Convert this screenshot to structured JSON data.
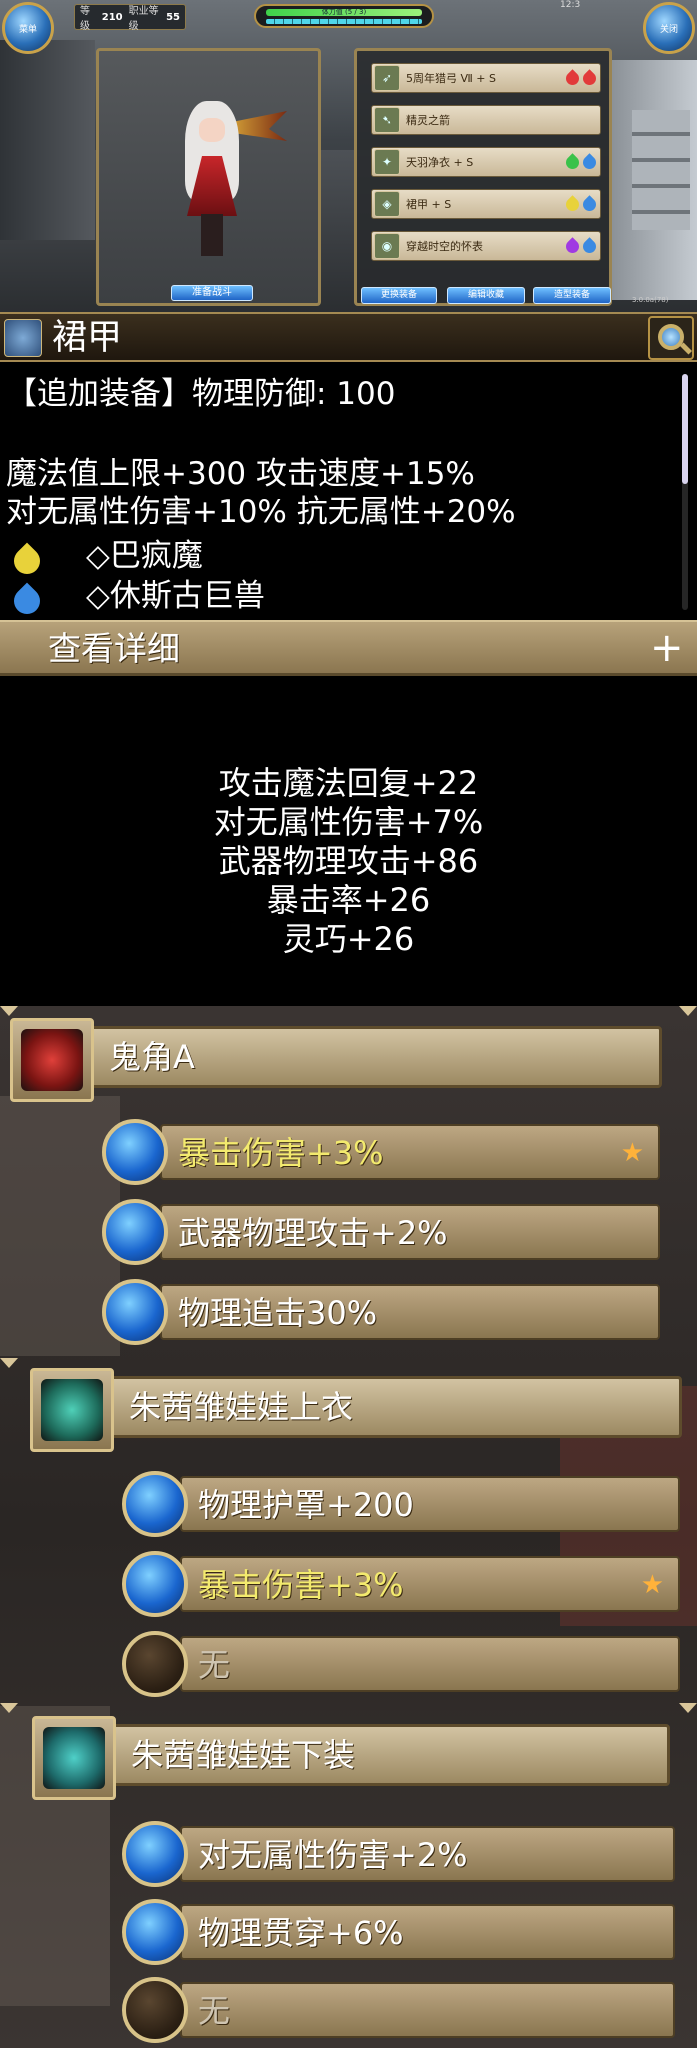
{
  "hud": {
    "left_orb_label": "菜单",
    "right_orb_label": "关闭",
    "level_label": "等级",
    "level_value": "210",
    "job_label": "职业等级",
    "job_value": "55",
    "hp_label": "体力值 (5 / 3)",
    "version": "3.0.0a(78)",
    "clock": "12:3"
  },
  "character": {
    "ready_button": "准备战斗"
  },
  "equipment_panel": {
    "items": [
      {
        "name": "5周年猎弓 Ⅶ + S",
        "icon": "bow-icon",
        "gems": [
          "red",
          "red"
        ]
      },
      {
        "name": "精灵之箭",
        "icon": "arrow-icon",
        "gems": []
      },
      {
        "name": "天羽净衣 + S",
        "icon": "robe-icon",
        "gems": [
          "green",
          "blue"
        ]
      },
      {
        "name": "裙甲 + S",
        "icon": "skirt-icon",
        "gems": [
          "yellow",
          "blue"
        ]
      },
      {
        "name": "穿越时空的怀表",
        "icon": "pocket-watch-icon",
        "gems": [
          "purple",
          "blue"
        ]
      }
    ],
    "buttons": [
      "更换装备",
      "编辑收藏",
      "造型装备"
    ]
  },
  "item": {
    "title": "裙甲",
    "line1": "【追加装备】物理防御: 100",
    "line2": "魔法值上限+300 攻击速度+15%",
    "line3": "对无属性伤害+10% 抗无属性+20%",
    "gem1": "◇巴疯魔",
    "gem2": "◇休斯古巨兽",
    "details_label": "查看详细",
    "details_plus": "+",
    "bonus": [
      "攻击魔法回复+22",
      "对无属性伤害+7%",
      "武器物理攻击+86",
      "暴击率+26",
      "灵巧+26"
    ]
  },
  "sets": [
    {
      "name": "鬼角A",
      "icon": "ribbon-icon",
      "rows": [
        {
          "text": "暴击伤害+3%",
          "style": "hl",
          "star": "★"
        },
        {
          "text": "武器物理攻击+2%",
          "style": "",
          "star": ""
        },
        {
          "text": "物理追击30%",
          "style": "",
          "star": ""
        }
      ]
    },
    {
      "name": "朱茜雏娃娃上衣",
      "icon": "armor-top-icon",
      "rows": [
        {
          "text": "物理护罩+200",
          "style": "",
          "star": ""
        },
        {
          "text": "暴击伤害+3%",
          "style": "hl",
          "star": "★"
        },
        {
          "text": "无",
          "style": "dim",
          "star": ""
        }
      ]
    },
    {
      "name": "朱茜雏娃娃下装",
      "icon": "armor-bottom-icon",
      "rows": [
        {
          "text": "对无属性伤害+2%",
          "style": "",
          "star": ""
        },
        {
          "text": "物理贯穿+6%",
          "style": "",
          "star": ""
        },
        {
          "text": "无",
          "style": "dim",
          "star": ""
        }
      ]
    }
  ],
  "colors": {
    "highlight_text": "#f3ea6e",
    "star": "#ffb23a",
    "gem_yellow": "#e8d23a",
    "gem_blue": "#3a8ae2"
  }
}
